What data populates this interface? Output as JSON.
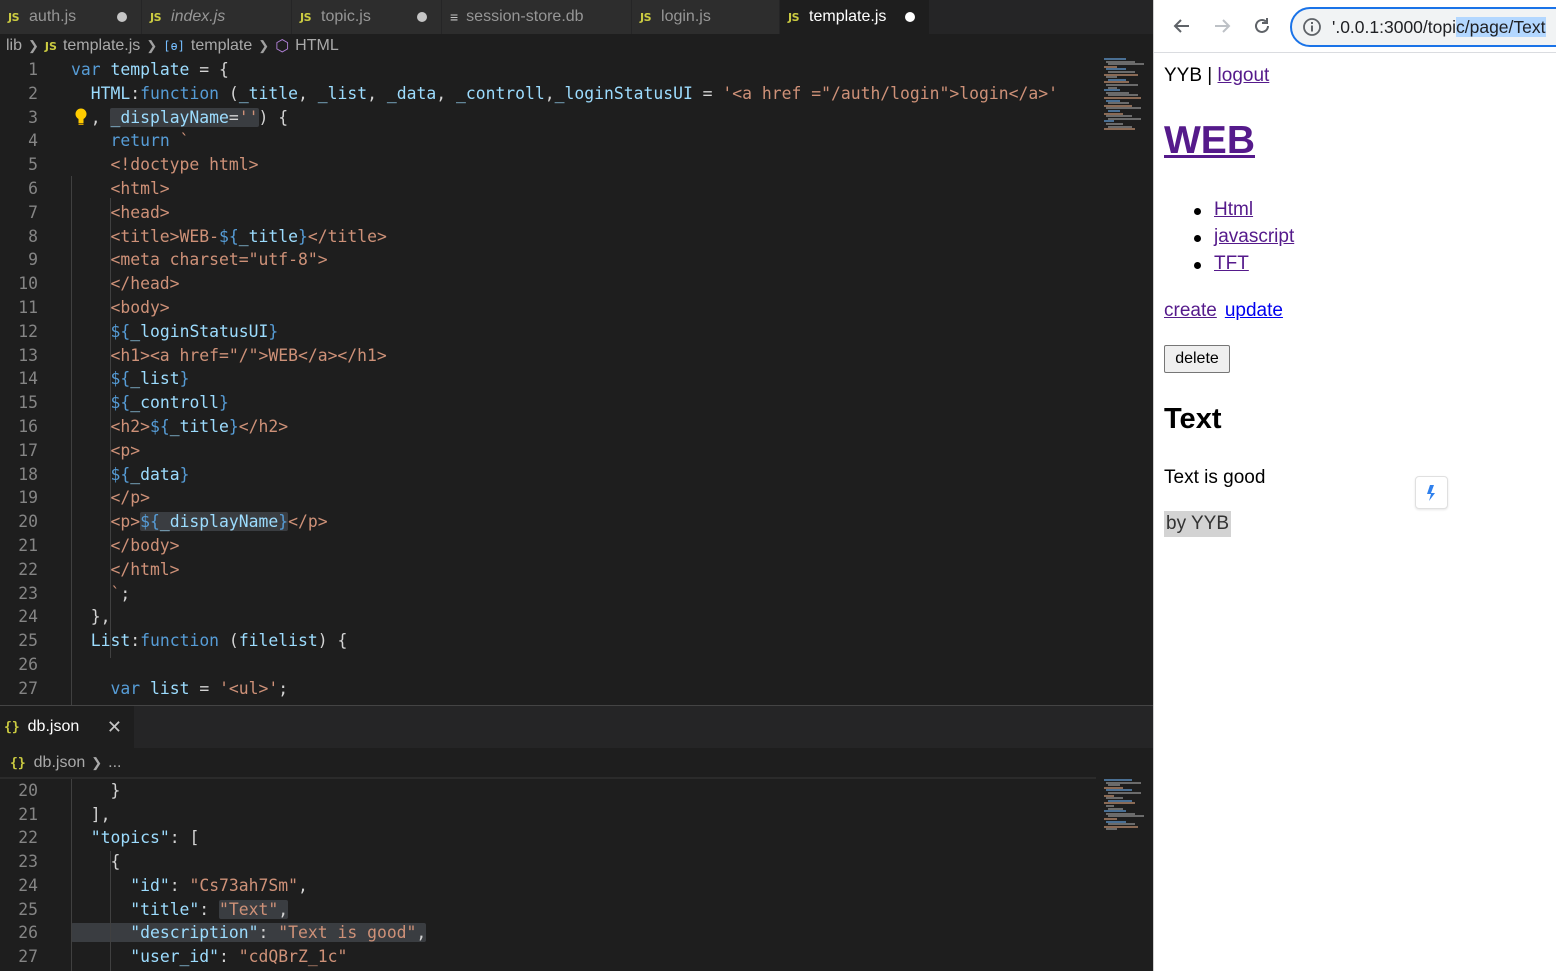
{
  "editor": {
    "tabs": [
      {
        "label": "auth.js",
        "icon": "js",
        "modified": true,
        "italic": false,
        "active": false
      },
      {
        "label": "index.js",
        "icon": "js",
        "modified": false,
        "italic": true,
        "active": false
      },
      {
        "label": "topic.js",
        "icon": "js",
        "modified": true,
        "italic": false,
        "active": false
      },
      {
        "label": "session-store.db",
        "icon": "file-lines",
        "modified": false,
        "italic": false,
        "active": false
      },
      {
        "label": "login.js",
        "icon": "js",
        "modified": false,
        "italic": false,
        "active": false
      },
      {
        "label": "template.js",
        "icon": "js",
        "modified": true,
        "italic": false,
        "active": true
      }
    ],
    "breadcrumb": [
      "lib",
      "template.js",
      "template",
      "HTML"
    ],
    "js_badge": "JS",
    "code_lines": [
      {
        "n": "1"
      },
      {
        "n": "2"
      },
      {
        "n": "3"
      },
      {
        "n": "4"
      },
      {
        "n": "5"
      },
      {
        "n": "6"
      },
      {
        "n": "7"
      },
      {
        "n": "8"
      },
      {
        "n": "9"
      },
      {
        "n": "10"
      },
      {
        "n": "11"
      },
      {
        "n": "12"
      },
      {
        "n": "13"
      },
      {
        "n": "14"
      },
      {
        "n": "15"
      },
      {
        "n": "16"
      },
      {
        "n": "17"
      },
      {
        "n": "18"
      },
      {
        "n": "19"
      },
      {
        "n": "20"
      },
      {
        "n": "21"
      },
      {
        "n": "22"
      },
      {
        "n": "23"
      },
      {
        "n": "24"
      },
      {
        "n": "25"
      },
      {
        "n": "26"
      },
      {
        "n": "27"
      }
    ],
    "code_text": [
      "var template = {",
      "  HTML:function (_title, _list, _data, _controll,_loginStatusUI = '<a href =\"/auth/login\">login</a>'",
      "  , _displayName='') {",
      "    return `",
      "    <!doctype html>",
      "    <html>",
      "    <head>",
      "    <title>WEB-${_title}</title>",
      "    <meta charset=\"utf-8\">",
      "    </head>",
      "    <body>",
      "    ${_loginStatusUI}",
      "    <h1><a href=\"/\">WEB</a></h1>",
      "    ${_list}",
      "    ${_controll}",
      "    <h2>${_title}</h2>",
      "    <p>",
      "    ${_data}",
      "    </p>",
      "    <p>${_displayName}</p>",
      "    </body>",
      "    </html>",
      "    `;",
      "  },",
      "  List:function (filelist) {",
      "",
      "    var list = '<ul>';"
    ],
    "panel2": {
      "tab_label": "db.json",
      "tab_icon": "{}",
      "close_glyph": "✕",
      "breadcrumb": [
        "db.json",
        "..."
      ],
      "line_numbers": [
        "20",
        "21",
        "22",
        "23",
        "24",
        "25",
        "26",
        "27"
      ],
      "code_text": [
        "    }",
        "  ],",
        "  \"topics\": [",
        "    {",
        "      \"id\": \"Cs73ah7Sm\",",
        "      \"title\": \"Text\",",
        "      \"description\": \"Text is good\",",
        "      \"user_id\": \"cdQBrZ_1c\""
      ]
    }
  },
  "browser": {
    "url_prefix": "'.0.0.1:3000/topi",
    "url_selected": "c/page/Text",
    "page": {
      "user": "YYB",
      "separator": " | ",
      "logout_label": "logout",
      "h1_label": "WEB",
      "topics": [
        "Html",
        "javascript",
        "TFT"
      ],
      "create_label": "create",
      "update_label": "update",
      "delete_label": "delete",
      "title": "Text",
      "description": "Text is good",
      "byline": "by YYB"
    }
  },
  "colors": {
    "keyword": "#569cd6",
    "variable": "#9cdcfe",
    "string": "#ce9178",
    "link_visited": "#551a8b",
    "link": "#0000ee",
    "focus_ring": "#1a73e8"
  }
}
